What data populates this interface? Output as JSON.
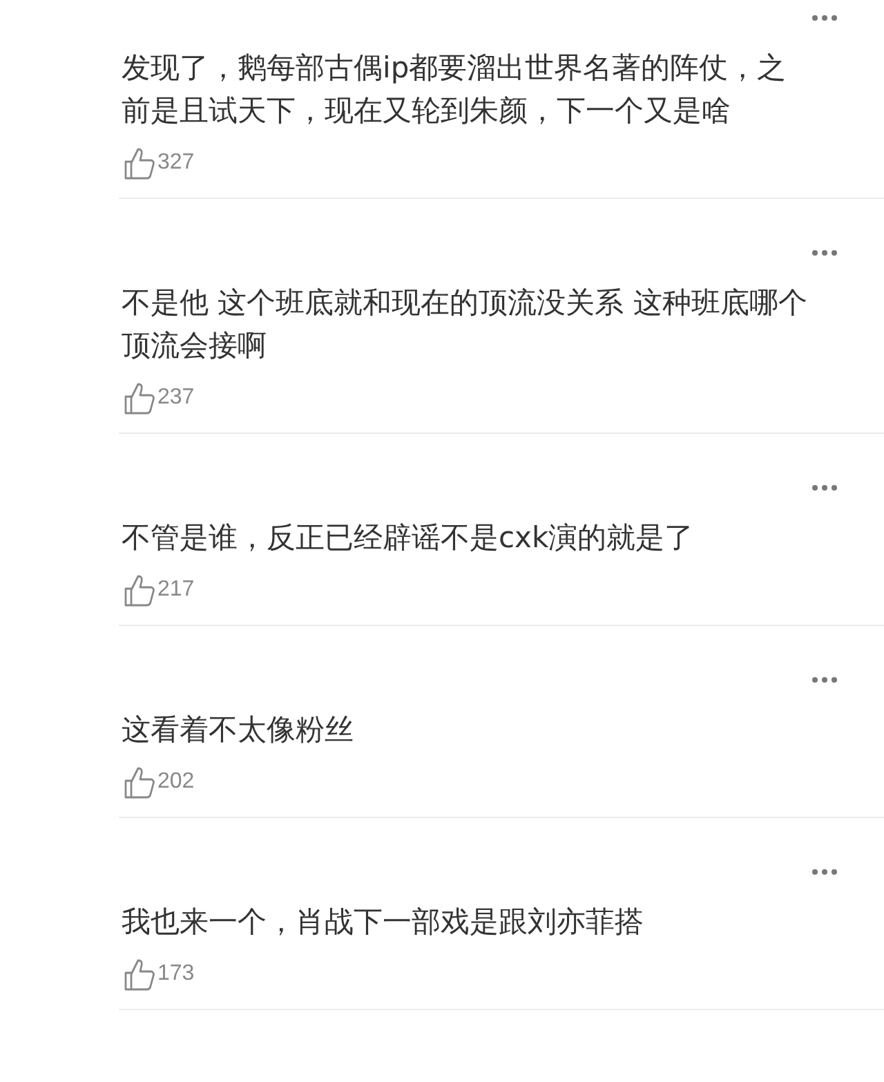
{
  "comments": [
    {
      "text": "发现了，鹅每部古偶ip都要溜出世界名著的阵仗，之前是且试天下，现在又轮到朱颜，下一个又是啥",
      "likes": "327"
    },
    {
      "text": "不是他 这个班底就和现在的顶流没关系 这种班底哪个顶流会接啊",
      "likes": "237"
    },
    {
      "text": "不管是谁，反正已经辟谣不是cxk演的就是了",
      "likes": "217"
    },
    {
      "text": "这看着不太像粉丝",
      "likes": "202"
    },
    {
      "text": "我也来一个，肖战下一部戏是跟刘亦菲搭",
      "likes": "173"
    }
  ]
}
